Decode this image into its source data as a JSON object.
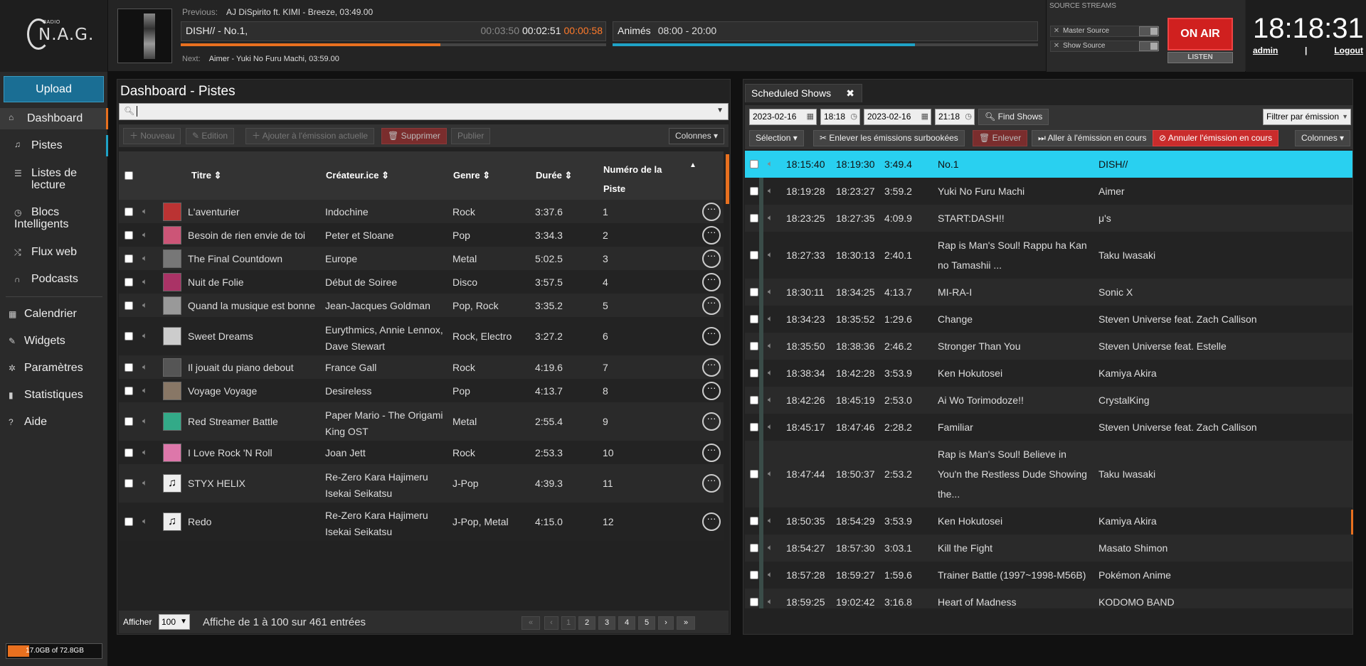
{
  "logo": {
    "radio": "RADIO",
    "name": "N.A.G."
  },
  "player": {
    "previous_label": "Previous:",
    "previous": "AJ DiSpirito ft. KIMI - Breeze, 03:49.00",
    "current_title": "DISH// - No.1,",
    "elapsed": "00:03:50",
    "remaining": "00:02:51",
    "countdown": "00:00:58",
    "track_progress_pct": 61,
    "next_label": "Next:",
    "next": "Aimer - Yuki No Furu Machi, 03:59.00",
    "show_name": "Animés",
    "show_time": "08:00 - 20:00",
    "show_progress_pct": 71
  },
  "streams": {
    "header": "SOURCE STREAMS",
    "master": "Master Source",
    "show": "Show Source",
    "on_air": "ON AIR",
    "listen": "LISTEN"
  },
  "clock": {
    "time": "18:18:31",
    "user": "admin",
    "sep": "|",
    "logout": "Logout"
  },
  "sidebar": {
    "upload": "Upload",
    "items": [
      {
        "label": "Dashboard",
        "icon": "home-icon"
      },
      {
        "label": "Pistes",
        "icon": "music-icon"
      },
      {
        "label": "Listes de lecture",
        "icon": "list-icon"
      },
      {
        "label": "Blocs Intelligents",
        "icon": "clock-icon"
      },
      {
        "label": "Flux web",
        "icon": "shuffle-icon"
      },
      {
        "label": "Podcasts",
        "icon": "headphones-icon"
      },
      {
        "label": "Calendrier",
        "icon": "calendar-icon"
      },
      {
        "label": "Widgets",
        "icon": "wrench-icon"
      },
      {
        "label": "Paramètres",
        "icon": "gear-icon"
      },
      {
        "label": "Statistiques",
        "icon": "bars-icon"
      },
      {
        "label": "Aide",
        "icon": "help-icon"
      }
    ],
    "storage": "17.0GB of 72.8GB",
    "storage_pct": 23
  },
  "tracks": {
    "title": "Dashboard - Pistes",
    "toolbar": {
      "new": "Nouveau",
      "edit": "Edition",
      "add": "Ajouter à l'émission actuelle",
      "delete": "Supprimer",
      "publish": "Publier",
      "columns": "Colonnes"
    },
    "headers": {
      "title": "Titre",
      "creator": "Créateur.ice",
      "genre": "Genre",
      "duration": "Durée",
      "track_num_1": "Numéro de la",
      "track_num_2": "Piste"
    },
    "rows": [
      {
        "title": "L'aventurier",
        "creator": "Indochine",
        "creator2": "",
        "genre": "Rock",
        "duration": "3:37.6",
        "num": "1"
      },
      {
        "title": "Besoin de rien envie de toi",
        "creator": "Peter et Sloane",
        "creator2": "",
        "genre": "Pop",
        "duration": "3:34.3",
        "num": "2"
      },
      {
        "title": "The Final Countdown",
        "creator": "Europe",
        "creator2": "",
        "genre": "Metal",
        "duration": "5:02.5",
        "num": "3"
      },
      {
        "title": "Nuit de Folie",
        "creator": "Début de Soiree",
        "creator2": "",
        "genre": "Disco",
        "duration": "3:57.5",
        "num": "4"
      },
      {
        "title": "Quand la musique est bonne",
        "creator": "Jean-Jacques Goldman",
        "creator2": "",
        "genre": "Pop, Rock",
        "duration": "3:35.2",
        "num": "5"
      },
      {
        "title": "Sweet Dreams",
        "creator": "Eurythmics, Annie Lennox,",
        "creator2": "Dave Stewart",
        "genre": "Rock, Electro",
        "duration": "3:27.2",
        "num": "6"
      },
      {
        "title": "Il jouait du piano debout",
        "creator": "France Gall",
        "creator2": "",
        "genre": "Rock",
        "duration": "4:19.6",
        "num": "7"
      },
      {
        "title": "Voyage Voyage",
        "creator": "Desireless",
        "creator2": "",
        "genre": "Pop",
        "duration": "4:13.7",
        "num": "8"
      },
      {
        "title": "Red Streamer Battle",
        "creator": "Paper Mario - The Origami",
        "creator2": "King OST",
        "genre": "Metal",
        "duration": "2:55.4",
        "num": "9"
      },
      {
        "title": "I Love Rock 'N Roll",
        "creator": "Joan Jett",
        "creator2": "",
        "genre": "Rock",
        "duration": "2:53.3",
        "num": "10"
      },
      {
        "title": "STYX HELIX",
        "creator": "Re-Zero Kara Hajimeru",
        "creator2": "Isekai Seikatsu",
        "genre": "J-Pop",
        "duration": "4:39.3",
        "num": "11"
      },
      {
        "title": "Redo",
        "creator": "Re-Zero Kara Hajimeru",
        "creator2": "Isekai Seikatsu",
        "genre": "J-Pop, Metal",
        "duration": "4:15.0",
        "num": "12"
      }
    ],
    "footer": {
      "show": "Afficher",
      "per_page": "100",
      "info": "Affiche de 1 à 100 sur 461 entrées"
    },
    "pages": [
      "«",
      "‹",
      "1",
      "2",
      "3",
      "4",
      "5",
      "›",
      "»"
    ]
  },
  "schedule": {
    "tab": "Scheduled Shows",
    "close": "✖",
    "start_date": "2023-02-16",
    "start_time": "18:18",
    "end_date": "2023-02-16",
    "end_time": "21:18",
    "find": "Find Shows",
    "filter": "Filtrer par émission",
    "selection": "Sélection",
    "remove_overbooked": "Enlever les émissions surbookées",
    "remove": "Enlever",
    "go_current": "Aller à l'émission en cours",
    "cancel_current": "Annuler l'émission en cours",
    "columns": "Colonnes",
    "rows": [
      {
        "start": "18:15:40",
        "end": "18:19:30",
        "dur": "3:49.4",
        "title": [
          "No.1"
        ],
        "artist": "DISH//"
      },
      {
        "start": "18:19:28",
        "end": "18:23:27",
        "dur": "3:59.2",
        "title": [
          "Yuki No Furu Machi"
        ],
        "artist": "Aimer"
      },
      {
        "start": "18:23:25",
        "end": "18:27:35",
        "dur": "4:09.9",
        "title": [
          "START:DASH!!"
        ],
        "artist": "μ's"
      },
      {
        "start": "18:27:33",
        "end": "18:30:13",
        "dur": "2:40.1",
        "title": [
          "Rap is Man's Soul! Rappu ha Kan",
          "no Tamashii ..."
        ],
        "artist": "Taku Iwasaki"
      },
      {
        "start": "18:30:11",
        "end": "18:34:25",
        "dur": "4:13.7",
        "title": [
          "MI-RA-I"
        ],
        "artist": "Sonic X"
      },
      {
        "start": "18:34:23",
        "end": "18:35:52",
        "dur": "1:29.6",
        "title": [
          "Change"
        ],
        "artist": "Steven Universe feat. Zach Callison"
      },
      {
        "start": "18:35:50",
        "end": "18:38:36",
        "dur": "2:46.2",
        "title": [
          "Stronger Than You"
        ],
        "artist": "Steven Universe feat. Estelle"
      },
      {
        "start": "18:38:34",
        "end": "18:42:28",
        "dur": "3:53.9",
        "title": [
          "Ken Hokutosei"
        ],
        "artist": "Kamiya Akira"
      },
      {
        "start": "18:42:26",
        "end": "18:45:19",
        "dur": "2:53.0",
        "title": [
          "Ai Wo Torimodoze!!"
        ],
        "artist": "CrystalKing"
      },
      {
        "start": "18:45:17",
        "end": "18:47:46",
        "dur": "2:28.2",
        "title": [
          "Familiar"
        ],
        "artist": "Steven Universe feat. Zach Callison"
      },
      {
        "start": "18:47:44",
        "end": "18:50:37",
        "dur": "2:53.2",
        "title": [
          "Rap is Man's Soul! Believe in",
          "You'n the Restless Dude Showing",
          "the..."
        ],
        "artist": "Taku Iwasaki"
      },
      {
        "start": "18:50:35",
        "end": "18:54:29",
        "dur": "3:53.9",
        "title": [
          "Ken Hokutosei"
        ],
        "artist": "Kamiya Akira"
      },
      {
        "start": "18:54:27",
        "end": "18:57:30",
        "dur": "3:03.1",
        "title": [
          "Kill the Fight"
        ],
        "artist": "Masato Shimon"
      },
      {
        "start": "18:57:28",
        "end": "18:59:27",
        "dur": "1:59.6",
        "title": [
          "Trainer Battle (1997~1998-M56B)"
        ],
        "artist": "Pokémon Anime"
      },
      {
        "start": "18:59:25",
        "end": "19:02:42",
        "dur": "3:16.8",
        "title": [
          "Heart of Madness"
        ],
        "artist": "KODOMO BAND"
      }
    ]
  }
}
